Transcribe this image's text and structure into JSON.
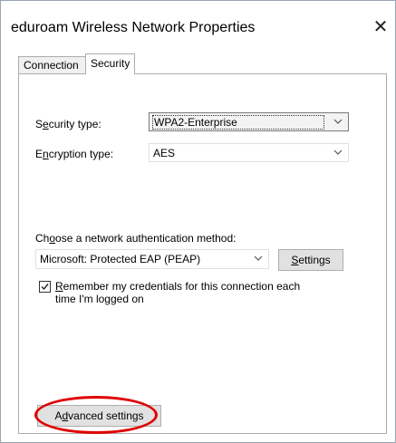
{
  "window": {
    "title": "eduroam Wireless Network Properties",
    "close_glyph": "✕"
  },
  "tabs": [
    {
      "label": "Connection"
    },
    {
      "label": "Security",
      "selected": true
    }
  ],
  "security": {
    "security_type_label_pre": "S",
    "security_type_label_u": "e",
    "security_type_label_post": "curity type:",
    "security_type_value": "WPA2-Enterprise",
    "encryption_type_label_pre": "E",
    "encryption_type_label_u": "n",
    "encryption_type_label_post": "cryption type:",
    "encryption_type_value": "AES",
    "auth_method_label_pre": "Ch",
    "auth_method_label_u": "o",
    "auth_method_label_post": "ose a network authentication method:",
    "auth_method_value": "Microsoft: Protected EAP (PEAP)",
    "settings_button_u": "S",
    "settings_button_post": "ettings",
    "remember_checked": true,
    "remember_label_u": "R",
    "remember_label_line1_post": "emember my credentials for this connection each",
    "remember_label_line2": "time I'm logged on",
    "advanced_button_pre": "A",
    "advanced_button_u": "d",
    "advanced_button_post": "vanced settings"
  },
  "colors": {
    "highlight": "#e00000",
    "border": "#adadad",
    "button_bg": "#e1e1e1"
  },
  "icons": {
    "close": "close-icon",
    "dropdown": "chevron-down-icon",
    "check": "checkmark-icon"
  }
}
